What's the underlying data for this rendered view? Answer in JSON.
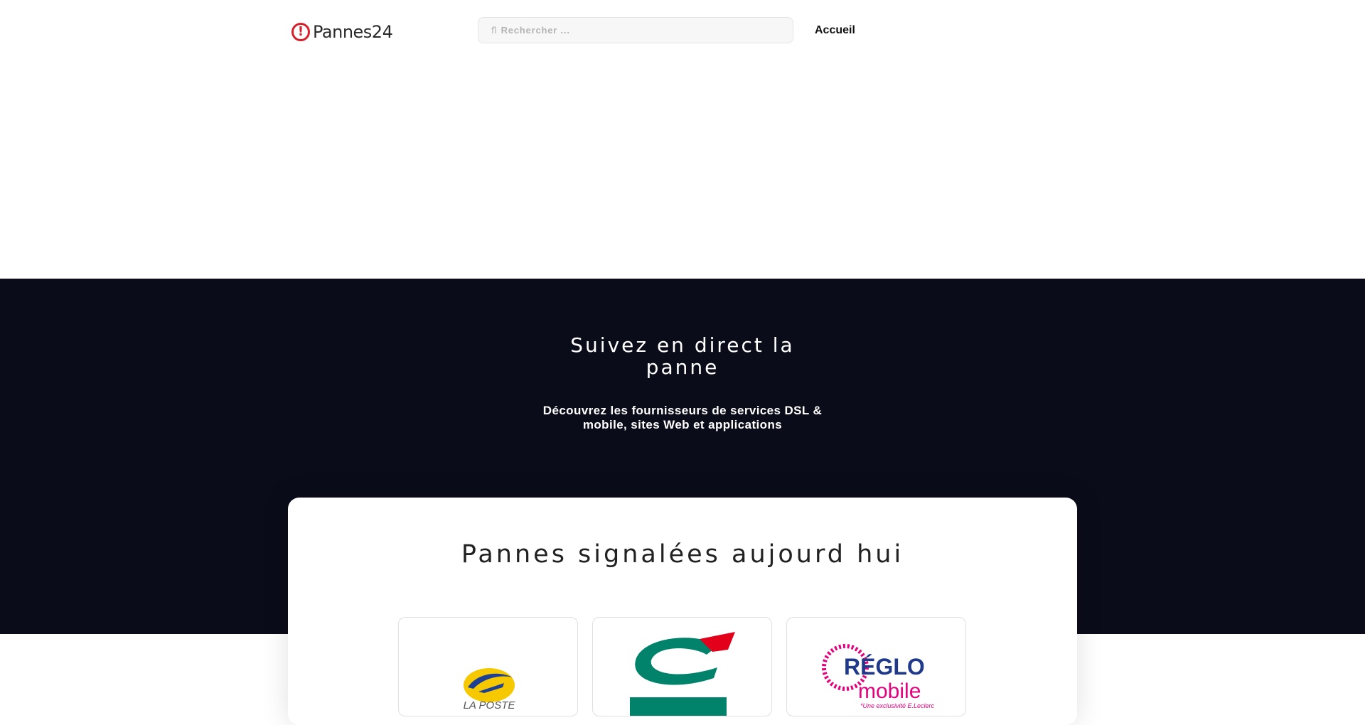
{
  "header": {
    "logo_text": "Pannes24",
    "logo_mark": "!",
    "search": {
      "icon": "search-icon",
      "placeholder": "Rechercher ..."
    },
    "nav": {
      "home_label": "Accueil"
    }
  },
  "hero": {
    "title": "Suivez en direct la panne",
    "subtitle": "Découvrez les fournisseurs de services DSL & mobile, sites Web et applications"
  },
  "outages": {
    "title": "Pannes signalées aujourd hui",
    "providers": [
      {
        "logo_text": "LA POSTE"
      },
      {
        "logo_text": "CA"
      },
      {
        "logo_text": "RÉGLO mobile",
        "logo_tagline": "*Une exclusivité E.Leclerc"
      }
    ]
  },
  "colors": {
    "brand_red": "#d8202a",
    "hero_bg": "#0b0c19",
    "la_poste_yellow": "#f5c800",
    "la_poste_blue": "#1d3f94",
    "ca_green": "#00836a",
    "ca_red": "#e2001a",
    "reglo_navy": "#1f3a8a",
    "reglo_pink": "#e6007e"
  }
}
